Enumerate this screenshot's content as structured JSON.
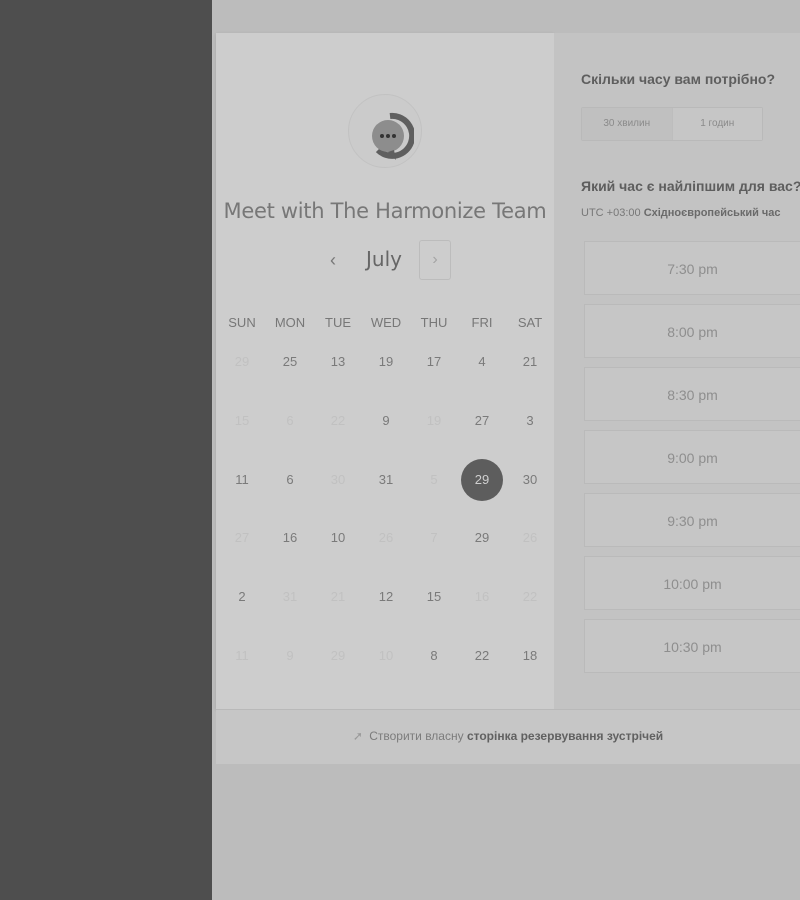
{
  "card": {
    "title": "Meet with The Harmonize Team",
    "month": "July",
    "prev_icon": "‹",
    "next_icon": "›"
  },
  "calendar": {
    "weekdays": [
      "SUN",
      "MON",
      "TUE",
      "WED",
      "THU",
      "FRI",
      "SAT"
    ],
    "weeks": [
      [
        {
          "d": "29",
          "m": true
        },
        {
          "d": "25",
          "m": false
        },
        {
          "d": "13",
          "m": false
        },
        {
          "d": "19",
          "m": false
        },
        {
          "d": "17",
          "m": false
        },
        {
          "d": "4",
          "m": false
        },
        {
          "d": "21",
          "m": false
        }
      ],
      [
        {
          "d": "15",
          "m": true
        },
        {
          "d": "6",
          "m": true
        },
        {
          "d": "22",
          "m": true
        },
        {
          "d": "9",
          "m": false
        },
        {
          "d": "19",
          "m": true
        },
        {
          "d": "27",
          "m": false
        },
        {
          "d": "3",
          "m": false
        }
      ],
      [
        {
          "d": "11",
          "m": false
        },
        {
          "d": "6",
          "m": false
        },
        {
          "d": "30",
          "m": true
        },
        {
          "d": "31",
          "m": false
        },
        {
          "d": "5",
          "m": true
        },
        {
          "d": "29",
          "m": false,
          "s": true
        },
        {
          "d": "30",
          "m": false
        }
      ],
      [
        {
          "d": "27",
          "m": true
        },
        {
          "d": "16",
          "m": false
        },
        {
          "d": "10",
          "m": false
        },
        {
          "d": "26",
          "m": true
        },
        {
          "d": "7",
          "m": true
        },
        {
          "d": "29",
          "m": false
        },
        {
          "d": "26",
          "m": true
        }
      ],
      [
        {
          "d": "2",
          "m": false
        },
        {
          "d": "31",
          "m": true
        },
        {
          "d": "21",
          "m": true
        },
        {
          "d": "12",
          "m": false
        },
        {
          "d": "15",
          "m": false
        },
        {
          "d": "16",
          "m": true
        },
        {
          "d": "22",
          "m": true
        }
      ],
      [
        {
          "d": "11",
          "m": true
        },
        {
          "d": "9",
          "m": true
        },
        {
          "d": "29",
          "m": true
        },
        {
          "d": "10",
          "m": true
        },
        {
          "d": "8",
          "m": false
        },
        {
          "d": "22",
          "m": false
        },
        {
          "d": "18",
          "m": false
        }
      ]
    ]
  },
  "scheduler": {
    "duration_question": "Скільки часу вам потрібно?",
    "durations": [
      "30 хвилин",
      "1 годин"
    ],
    "time_question": "Який час є найліпшим для вас?",
    "tz_offset": "UTC +03:00",
    "tz_name": "Східноєвропейський час",
    "slots": [
      "7:30 pm",
      "8:00 pm",
      "8:30 pm",
      "9:00 pm",
      "9:30 pm",
      "10:00 pm",
      "10:30 pm"
    ]
  },
  "footer": {
    "prefix": "Створити власну",
    "link": "сторінка резервування зустрічей"
  }
}
